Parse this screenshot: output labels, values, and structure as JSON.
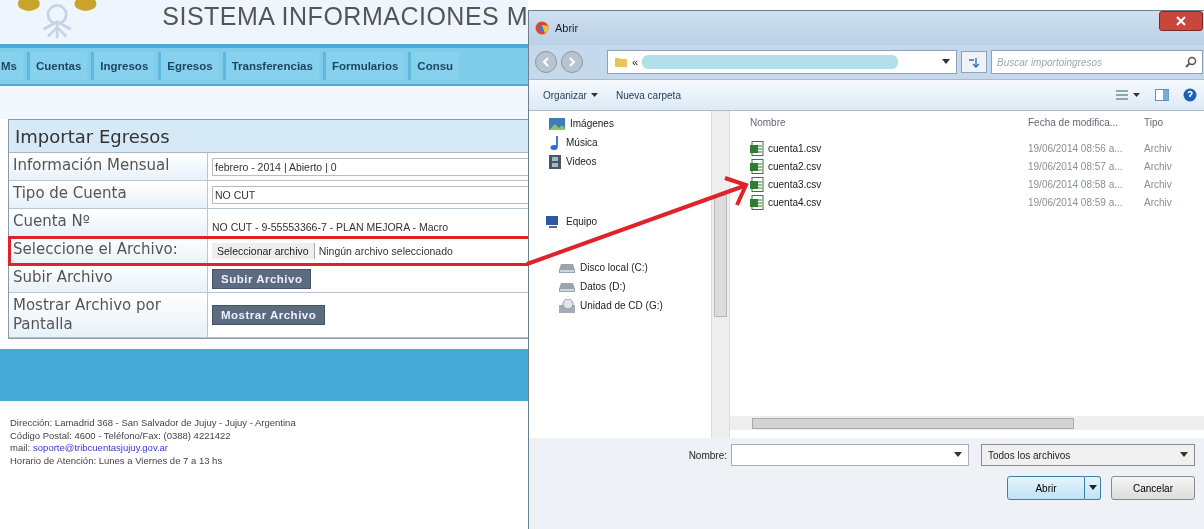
{
  "header": {
    "title": "SISTEMA INFORMACIONES M"
  },
  "nav": [
    {
      "label": "Ms"
    },
    {
      "label": "Cuentas"
    },
    {
      "label": "Ingresos"
    },
    {
      "label": "Egresos"
    },
    {
      "label": "Transferencias"
    },
    {
      "label": "Formularios"
    },
    {
      "label": "Consu"
    }
  ],
  "form": {
    "title": "Importar Egresos",
    "rows": [
      {
        "label": "Información Mensual",
        "kind": "field",
        "value": "febrero - 2014 | Abierto | 0",
        "highlighted": false
      },
      {
        "label": "Tipo de Cuenta",
        "kind": "field",
        "value": "NO CUT",
        "highlighted": false
      },
      {
        "label": "Cuenta Nº",
        "kind": "text",
        "value": "NO CUT - 9-55553366-7 - PLAN MEJORA - Macro",
        "highlighted": false
      },
      {
        "label": "Seleccione el Archivo:",
        "kind": "file",
        "button": "Seleccionar archivo",
        "status": "Ningún archivo seleccionado",
        "highlighted": true
      },
      {
        "label": "Subir Archivo",
        "kind": "button",
        "button": "Subir Archivo",
        "highlighted": false
      },
      {
        "label": "Mostrar Archivo por Pantalla",
        "kind": "button",
        "button": "Mostrar Archivo",
        "highlighted": false
      }
    ]
  },
  "footer": {
    "lines": [
      "Dirección: Lamadrid 368 - San Salvador de Jujuy - Jujuy - Argentina",
      "Código Postal: 4600 - Teléfono/Fax: (0388) 4221422"
    ],
    "mail_label": "mail:",
    "mail": "soporte@tribcuentasjujuy.gov.ar",
    "hours": "Horario de Atención: Lunes a Viernes de 7 a 13 hs"
  },
  "dialog": {
    "title": "Abrir",
    "path_prefix": "«",
    "search": {
      "placeholder": "Buscar importoingresos"
    },
    "toolbar": [
      {
        "label": "Organizar",
        "caret": true
      },
      {
        "label": "Nueva carpeta",
        "caret": false
      }
    ],
    "nav_pane": [
      {
        "label": "Imágenes",
        "kind": "pictures"
      },
      {
        "label": "Música",
        "kind": "music"
      },
      {
        "label": "Videos",
        "kind": "videos"
      },
      {
        "label": "Equipo",
        "kind": "computer",
        "children": [
          {
            "label": "Disco local (C:)",
            "kind": "drive"
          },
          {
            "label": "Datos (D:)",
            "kind": "drive"
          },
          {
            "label": "Unidad de CD (G:)",
            "kind": "cd"
          }
        ]
      }
    ],
    "columns": [
      "Nombre",
      "Fecha de modifica...",
      "Tipo"
    ],
    "files": [
      {
        "name": "cuenta1.csv",
        "date": "19/06/2014 08:56 a...",
        "type": "Archiv"
      },
      {
        "name": "cuenta2.csv",
        "date": "19/06/2014 08:57 a...",
        "type": "Archiv"
      },
      {
        "name": "cuenta3.csv",
        "date": "19/06/2014 08:58 a...",
        "type": "Archiv"
      },
      {
        "name": "cuenta4.csv",
        "date": "19/06/2014 08:59 a...",
        "type": "Archiv"
      }
    ],
    "filename_label": "Nombre:",
    "filter": "Todos los archivos",
    "open_button": "Abrir",
    "cancel_button": "Cancelar"
  }
}
